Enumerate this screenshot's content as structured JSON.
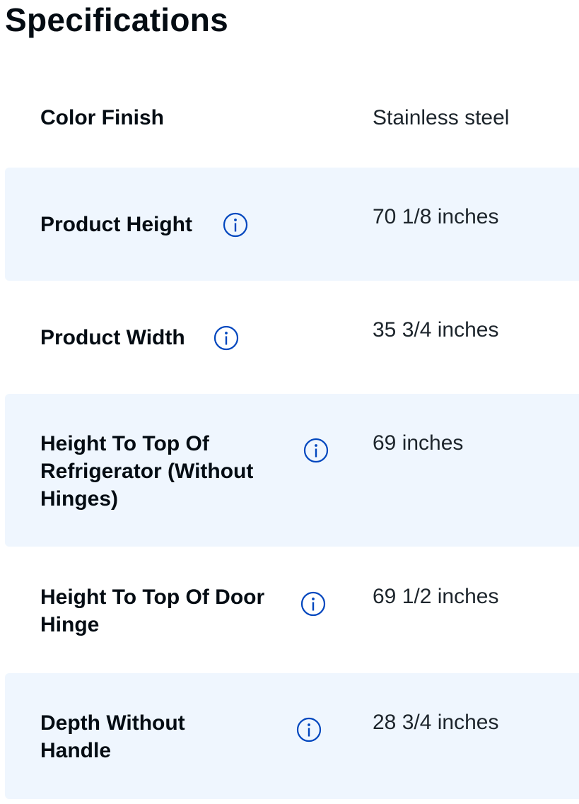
{
  "page_title": "Specifications",
  "info_icon": "info-circle-icon",
  "accent_color": "#0046be",
  "specs": [
    {
      "label": "Color Finish",
      "value": "Stainless steel"
    },
    {
      "label": "Product Height",
      "value": "70 1/8 inches"
    },
    {
      "label": "Product Width",
      "value": "35 3/4 inches"
    },
    {
      "label": "Height To Top Of Refrigerator (Without Hinges)",
      "value": "69 inches"
    },
    {
      "label": "Height To Top Of Door Hinge",
      "value": "69 1/2 inches"
    },
    {
      "label": "Depth Without Handle",
      "value": "28 3/4 inches"
    }
  ]
}
